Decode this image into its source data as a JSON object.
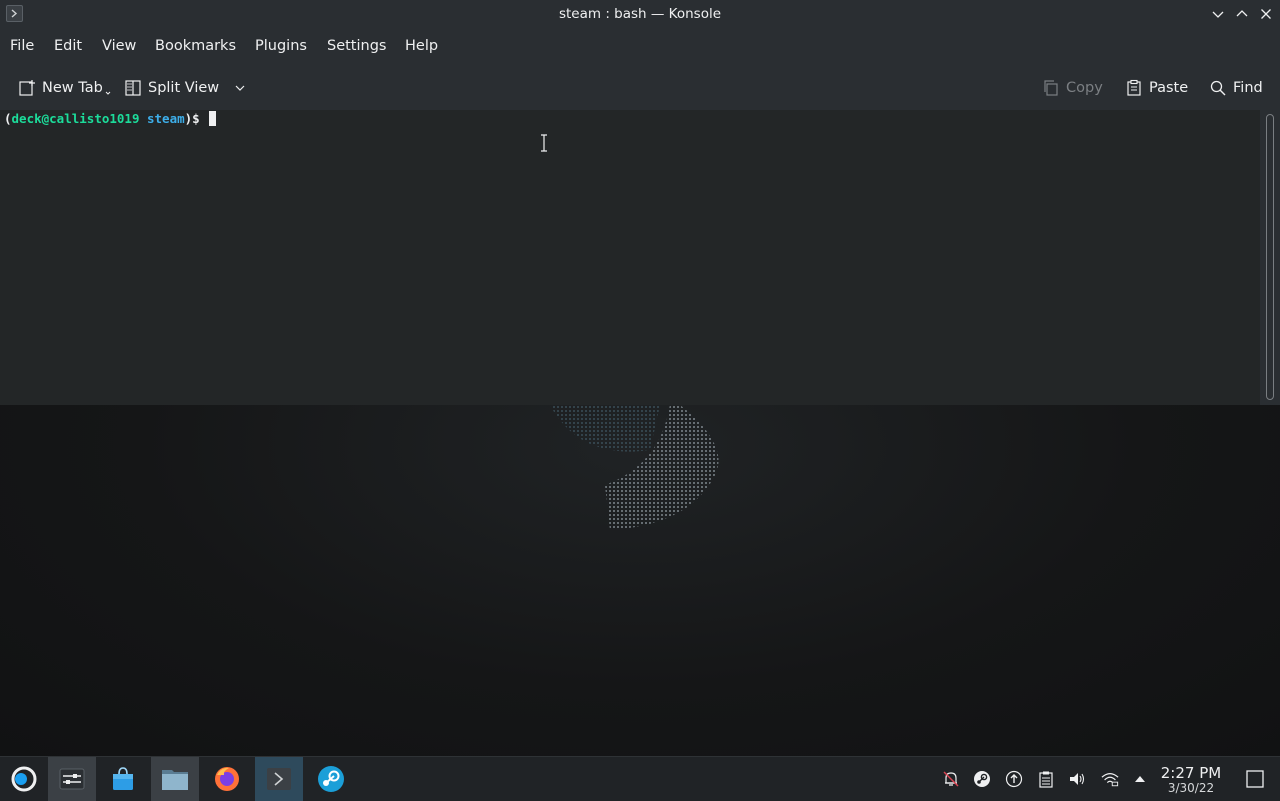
{
  "window": {
    "title": "steam : bash — Konsole"
  },
  "menu": {
    "items": [
      "File",
      "Edit",
      "View",
      "Bookmarks",
      "Plugins",
      "Settings",
      "Help"
    ]
  },
  "toolbar": {
    "new_tab": "New Tab",
    "split_view": "Split View",
    "copy": "Copy",
    "paste": "Paste",
    "find": "Find"
  },
  "terminal": {
    "prompt_open": "(",
    "user_host": "deck@callisto1019",
    "directory": "steam",
    "prompt_close": ")$"
  },
  "taskbar": {
    "apps": [
      "application-launcher-icon",
      "settings-icon",
      "discover-store-icon",
      "file-manager-icon",
      "firefox-icon",
      "konsole-icon",
      "steam-icon"
    ],
    "tray": [
      "notifications-icon",
      "steam-tray-icon",
      "update-icon",
      "clipboard-icon",
      "volume-icon",
      "network-icon",
      "expand-tray-icon"
    ],
    "clock_time": "2:27 PM",
    "clock_date": "3/30/22"
  },
  "colors": {
    "window_bg": "#2a2e32",
    "terminal_bg": "#232627",
    "prompt_user": "#1cdc9a",
    "prompt_dir": "#3daee9",
    "taskbar_bg": "#202326"
  }
}
